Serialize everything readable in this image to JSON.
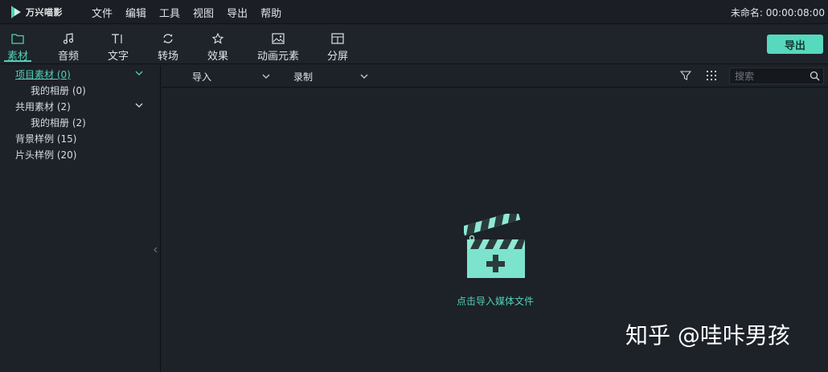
{
  "app": {
    "name": "万兴喵影",
    "title_right": "未命名: 00:00:08:00"
  },
  "menu": [
    "文件",
    "编辑",
    "工具",
    "视图",
    "导出",
    "帮助"
  ],
  "toolbar": {
    "tabs": [
      {
        "label": "素材",
        "icon": "folder-icon",
        "active": true
      },
      {
        "label": "音频",
        "icon": "music-note-icon"
      },
      {
        "label": "文字",
        "icon": "text-icon"
      },
      {
        "label": "转场",
        "icon": "transition-icon"
      },
      {
        "label": "效果",
        "icon": "effects-icon"
      },
      {
        "label": "动画元素",
        "icon": "image-icon"
      },
      {
        "label": "分屏",
        "icon": "split-screen-icon"
      }
    ],
    "export_label": "导出"
  },
  "sidebar": {
    "items": [
      {
        "label": "项目素材 (0)",
        "active": true,
        "has_chevron": true
      },
      {
        "label": "我的相册 (0)"
      },
      {
        "label": "共用素材 (2)",
        "has_chevron": true
      },
      {
        "label": "我的相册 (2)"
      },
      {
        "label": "背景样例 (15)"
      },
      {
        "label": "片头样例 (20)"
      }
    ]
  },
  "filterbar": {
    "import_label": "导入",
    "record_label": "录制",
    "search_placeholder": "搜索"
  },
  "media": {
    "empty_text": "点击导入媒体文件"
  },
  "watermark": "知乎 @哇咔男孩",
  "colors": {
    "accent": "#52d1b6",
    "background": "#1d2128"
  }
}
